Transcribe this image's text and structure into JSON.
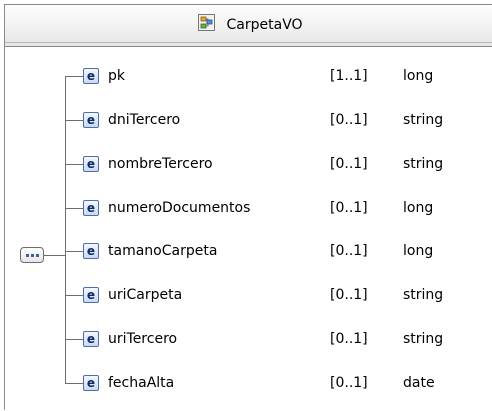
{
  "class": {
    "title": "CarpetaVO",
    "icon": "complex-type-icon",
    "collapse_icon": "sequence-icon"
  },
  "elements": [
    {
      "icon_label": "e",
      "name": "pk",
      "cardinality": "[1..1]",
      "type": "long"
    },
    {
      "icon_label": "e",
      "name": "dniTercero",
      "cardinality": "[0..1]",
      "type": "string"
    },
    {
      "icon_label": "e",
      "name": "nombreTercero",
      "cardinality": "[0..1]",
      "type": "string"
    },
    {
      "icon_label": "e",
      "name": "numeroDocumentos",
      "cardinality": "[0..1]",
      "type": "long"
    },
    {
      "icon_label": "e",
      "name": "tamanoCarpeta",
      "cardinality": "[0..1]",
      "type": "long"
    },
    {
      "icon_label": "e",
      "name": "uriCarpeta",
      "cardinality": "[0..1]",
      "type": "string"
    },
    {
      "icon_label": "e",
      "name": "uriTercero",
      "cardinality": "[0..1]",
      "type": "string"
    },
    {
      "icon_label": "e",
      "name": "fechaAlta",
      "cardinality": "[0..1]",
      "type": "date"
    }
  ],
  "colors": {
    "border": "#8a8a8a",
    "connector": "#6f6f6f",
    "element_icon_border": "#4d6ea8",
    "element_icon_text": "#0b2b6b"
  }
}
